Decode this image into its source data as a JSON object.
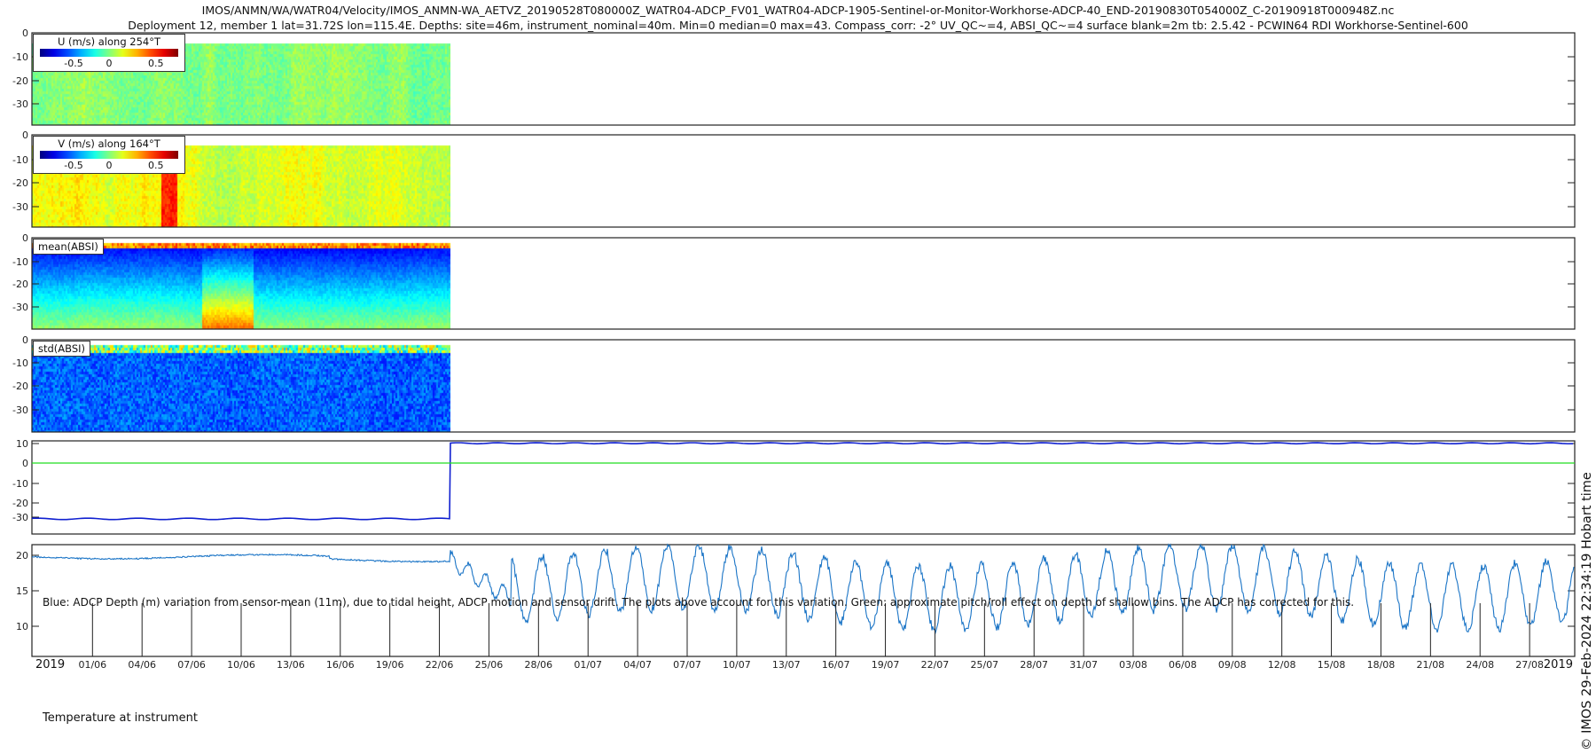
{
  "header": {
    "line1": "IMOS/ANMN/WA/WATR04/Velocity/IMOS_ANMN-WA_AETVZ_20190528T080000Z_WATR04-ADCP_FV01_WATR04-ADCP-1905-Sentinel-or-Monitor-Workhorse-ADCP-40_END-20190830T054000Z_C-20190918T000948Z.nc",
    "line2": "Deployment 12, member 1 lat=31.72S lon=115.4E. Depths: site=46m, instrument_nominal=40m. Min=0 median=0 max=43. Compass_corr: -2° UV_QC~=4, ABSI_QC~=4 surface blank=2m tb: 2.5.42 - PCWIN64 RDI Workhorse-Sentinel-600"
  },
  "stamp": "© IMOS 29-Feb-2024 22:34:19 Hobart time",
  "colors": {
    "depth_line": "#1020d0",
    "pitch_line": "#22dd22",
    "temp_line": "#1a74c6",
    "axis": "#222222"
  },
  "chart_data": [
    {
      "type": "heatmap",
      "id": "u",
      "legend": "U (m/s) along 254°T",
      "colorbar_ticks": [
        "-0.5",
        "0",
        "0.5"
      ],
      "clim": [
        -0.75,
        0.75
      ],
      "ylim": [
        0,
        38.5
      ],
      "yticks": [
        "0",
        "-10",
        "-20",
        "-30"
      ],
      "bias": 0.0,
      "spread": 0.18
    },
    {
      "type": "heatmap",
      "id": "v",
      "legend": "V (m/s) along 164°T",
      "colorbar_ticks": [
        "-0.5",
        "0",
        "0.5"
      ],
      "clim": [
        -0.75,
        0.75
      ],
      "ylim": [
        0,
        38.5
      ],
      "yticks": [
        "0",
        "-10",
        "-20",
        "-30"
      ],
      "bias": 0.15,
      "spread": 0.25
    },
    {
      "type": "heatmap",
      "id": "mean_absi",
      "legend": "mean(ABSI)",
      "ylim": [
        0,
        38.5
      ],
      "yticks": [
        "0",
        "-10",
        "-20",
        "-30"
      ]
    },
    {
      "type": "heatmap",
      "id": "std_absi",
      "legend": "std(ABSI)",
      "ylim": [
        0,
        38.5
      ],
      "yticks": [
        "0",
        "-10",
        "-20",
        "-30"
      ]
    },
    {
      "type": "line",
      "id": "depth",
      "yticks": [
        "10",
        "0",
        "-10",
        "-20",
        "-30"
      ],
      "ylim": [
        -39,
        12.3
      ],
      "series": [
        {
          "name": "ADCP depth variation",
          "before": -31,
          "after": 11
        },
        {
          "name": "pitch/roll effect",
          "value": 0
        }
      ],
      "annotation": "Blue: ADCP Depth (m) variation from sensor-mean (11m), due to tidal height, ADCP motion and sensor drift. The plots above account for this variation. Green: approximate pitch/roll effect on depth of shallow bins. The ADCP has corrected for this."
    },
    {
      "type": "line",
      "id": "temperature",
      "yticks": [
        "20",
        "15",
        "10"
      ],
      "ylim": [
        8.8,
        21.5
      ],
      "label": "Temperature at instrument",
      "series": [
        {
          "name": "temperature",
          "stable_value": 19.6,
          "oscillation_range": [
            9,
            21.5
          ]
        }
      ]
    }
  ],
  "xaxis": {
    "year_left": "2019",
    "year_right": "2019",
    "ticks": [
      "01/06",
      "04/06",
      "07/06",
      "10/06",
      "13/06",
      "16/06",
      "19/06",
      "22/06",
      "25/06",
      "28/06",
      "01/07",
      "04/07",
      "07/07",
      "10/07",
      "13/07",
      "16/07",
      "19/07",
      "22/07",
      "25/07",
      "28/07",
      "31/07",
      "03/08",
      "06/08",
      "09/08",
      "12/08",
      "15/08",
      "18/08",
      "21/08",
      "24/08",
      "27/08"
    ]
  }
}
